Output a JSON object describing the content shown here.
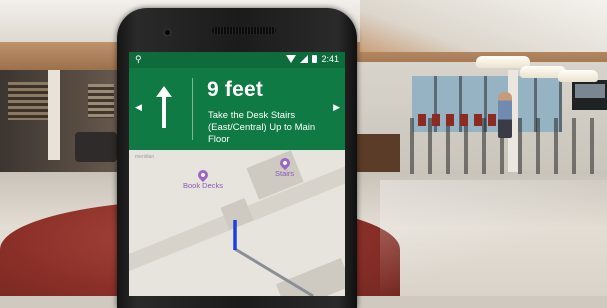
{
  "status_bar": {
    "time": "2:41",
    "pin_glyph": "⚲",
    "icons": [
      "wifi-icon",
      "signal-icon",
      "battery-icon"
    ]
  },
  "navigation": {
    "distance": "9 feet",
    "instruction": "Take the Desk Stairs (East/Central) Up to Main Floor",
    "prev_glyph": "◀",
    "next_glyph": "▶",
    "maneuver_icon": "arrow-up-icon"
  },
  "map": {
    "watermark": "meridian",
    "pois": [
      {
        "label": "Book Decks",
        "icon": "place-pin-icon"
      },
      {
        "label": "Stairs",
        "icon": "place-pin-icon"
      }
    ],
    "colors": {
      "route_active": "#1f3fd6",
      "route_path": "#8a8f96",
      "poi": "#9a66c8"
    }
  },
  "colors": {
    "nav_green": "#0f7a44",
    "status_green": "#0d6b3c"
  }
}
